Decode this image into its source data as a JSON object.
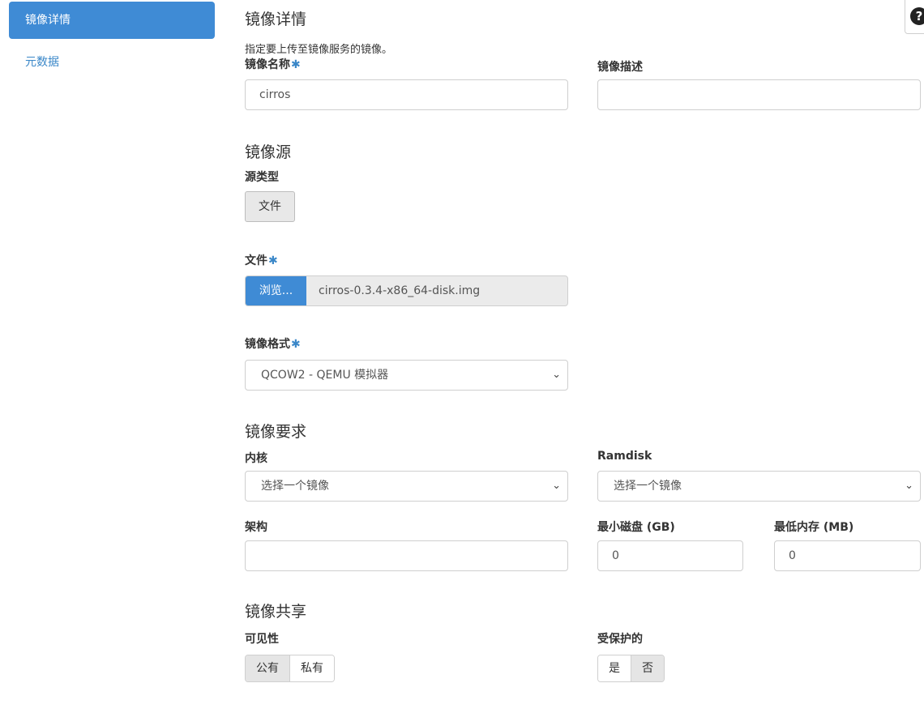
{
  "sidebar": {
    "items": [
      {
        "label": "镜像详情"
      },
      {
        "label": "元数据"
      }
    ]
  },
  "help": {
    "icon": "?"
  },
  "details": {
    "title": "镜像详情",
    "description": "指定要上传至镜像服务的镜像。",
    "name_label": "镜像名称",
    "name_value": "cirros",
    "desc_label": "镜像描述",
    "desc_value": ""
  },
  "required_mark": "✱",
  "source": {
    "title": "镜像源",
    "type_label": "源类型",
    "type_button": "文件",
    "file_label": "文件",
    "browse_label": "浏览...",
    "file_name": "cirros-0.3.4-x86_64-disk.img"
  },
  "format": {
    "label": "镜像格式",
    "selected": "QCOW2 - QEMU 模拟器"
  },
  "requirements": {
    "title": "镜像要求",
    "kernel_label": "内核",
    "kernel_selected": "选择一个镜像",
    "ramdisk_label": "Ramdisk",
    "ramdisk_selected": "选择一个镜像",
    "arch_label": "架构",
    "arch_value": "",
    "min_disk_label": "最小磁盘 (GB)",
    "min_disk_value": "0",
    "min_ram_label": "最低内存 (MB)",
    "min_ram_value": "0"
  },
  "sharing": {
    "title": "镜像共享",
    "visibility_label": "可见性",
    "visibility_options": [
      "公有",
      "私有"
    ],
    "protected_label": "受保护的",
    "protected_options": [
      "是",
      "否"
    ]
  },
  "colors": {
    "accent": "#3f8bd5",
    "link": "#3a87c8"
  }
}
